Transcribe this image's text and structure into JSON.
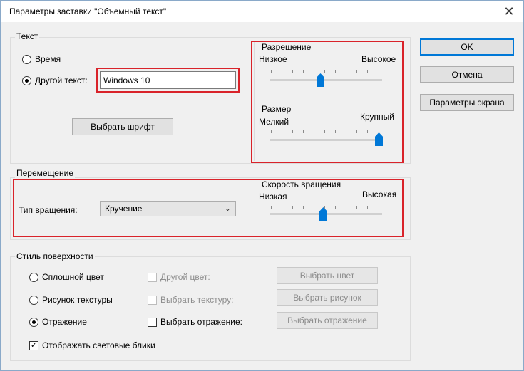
{
  "window": {
    "title": "Параметры заставки \"Объемный текст\"",
    "close_glyph": "✕"
  },
  "text_group": {
    "label": "Текст",
    "radio_time": "Время",
    "radio_other": "Другой текст:",
    "text_value": "Windows 10",
    "font_button": "Выбрать шрифт"
  },
  "resolution": {
    "label": "Разрешение",
    "low": "Низкое",
    "high": "Высокое",
    "value": 0.5
  },
  "size": {
    "label": "Размер",
    "small": "Мелкий",
    "large": "Крупный",
    "value": 1.0
  },
  "motion_group": {
    "label": "Перемещение",
    "rotation_type_label": "Тип вращения:",
    "rotation_type_value": "Кручение"
  },
  "speed": {
    "label": "Скорость вращения",
    "low": "Низкая",
    "high": "Высокая",
    "value": 0.5
  },
  "surface_group": {
    "label": "Стиль поверхности",
    "solid": "Сплошной цвет",
    "texture": "Рисунок текстуры",
    "reflection": "Отражение",
    "other_color": "Другой цвет:",
    "choose_texture": "Выбрать текстуру:",
    "choose_reflection": "Выбрать отражение:",
    "btn_color": "Выбрать цвет",
    "btn_picture": "Выбрать рисунок",
    "btn_reflection": "Выбрать отражение",
    "highlights": "Отображать световые блики",
    "highlights_checked": true
  },
  "buttons": {
    "ok": "OK",
    "cancel": "Отмена",
    "screen_params": "Параметры экрана"
  },
  "colors": {
    "accent": "#0078d7",
    "highlight_box": "#d9232a"
  }
}
